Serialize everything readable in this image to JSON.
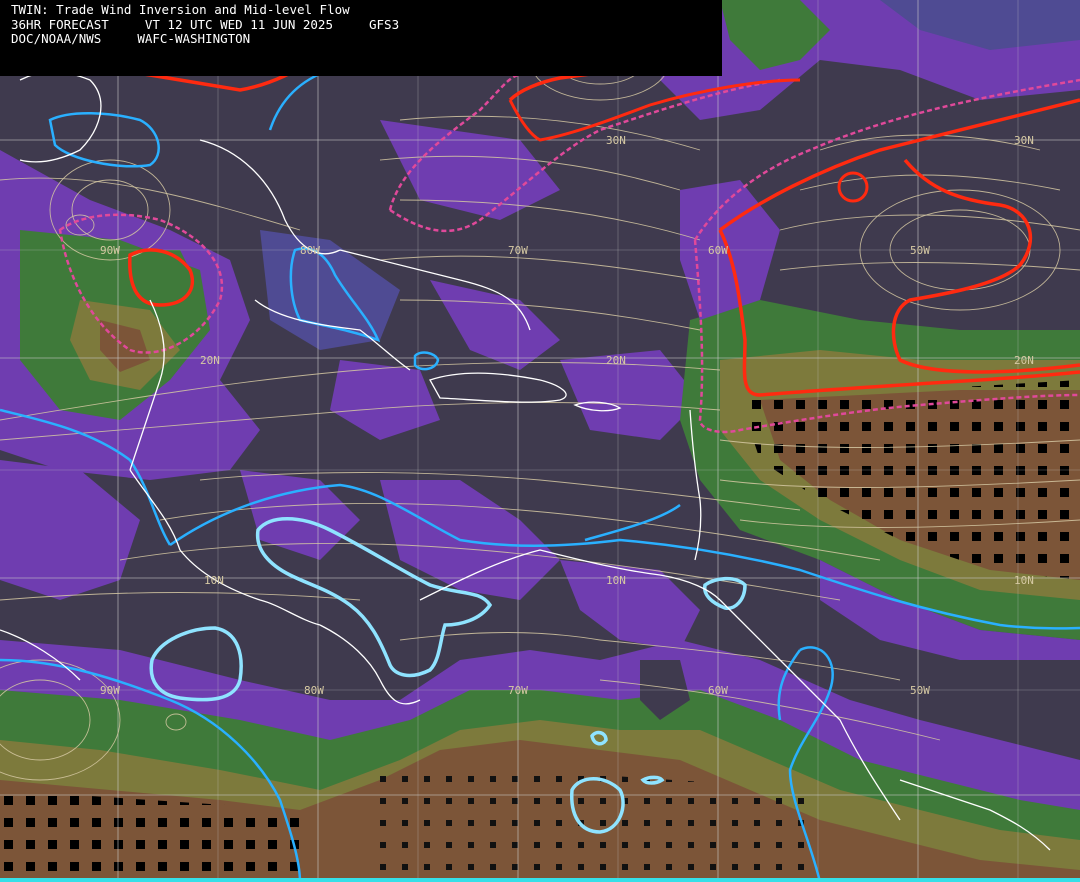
{
  "header": {
    "title": "TWIN: Trade Wind Inversion and Mid-level Flow",
    "forecast": "36HR FORECAST",
    "valid_time": "VT 12 UTC WED 11 JUN 2025",
    "model": "GFS3",
    "agency": "DOC/NOAA/NWS",
    "center": "WAFC-WASHINGTON"
  },
  "map_labels": {
    "lat_30": "30N",
    "lat_30_east": "30N",
    "lat_20": "20N",
    "lat_20_center": "20N",
    "lat_20_east": "20N",
    "lat_10": "10N",
    "lat_10_center": "10N",
    "lat_10_east": "10N",
    "lon_90": "90W",
    "lon_80": "80W",
    "lon_70": "70W",
    "lon_60": "60W",
    "lon_50": "50W",
    "lon_90_south": "90W",
    "lon_80_south": "80W",
    "lon_70_south": "70W",
    "lon_60_south": "60W",
    "lon_50_south": "50W"
  },
  "colors": {
    "background": "#3f3a4e",
    "purple": "#6f3db0",
    "blue_purple": "#4f4b93",
    "green": "#3f7a3a",
    "olive": "#7d7a3c",
    "brown": "#7c5538",
    "streamline": "#d6c9a3",
    "coast": "#ffffff",
    "cyan_contour": "#2ab0ff",
    "red_contour": "#ff2a10",
    "magenta_dashed": "#e0499a",
    "grid": "#c9c9c9",
    "bottom_bar": "#35e0e8"
  },
  "legend": {
    "top_bar_color": "#000000"
  }
}
